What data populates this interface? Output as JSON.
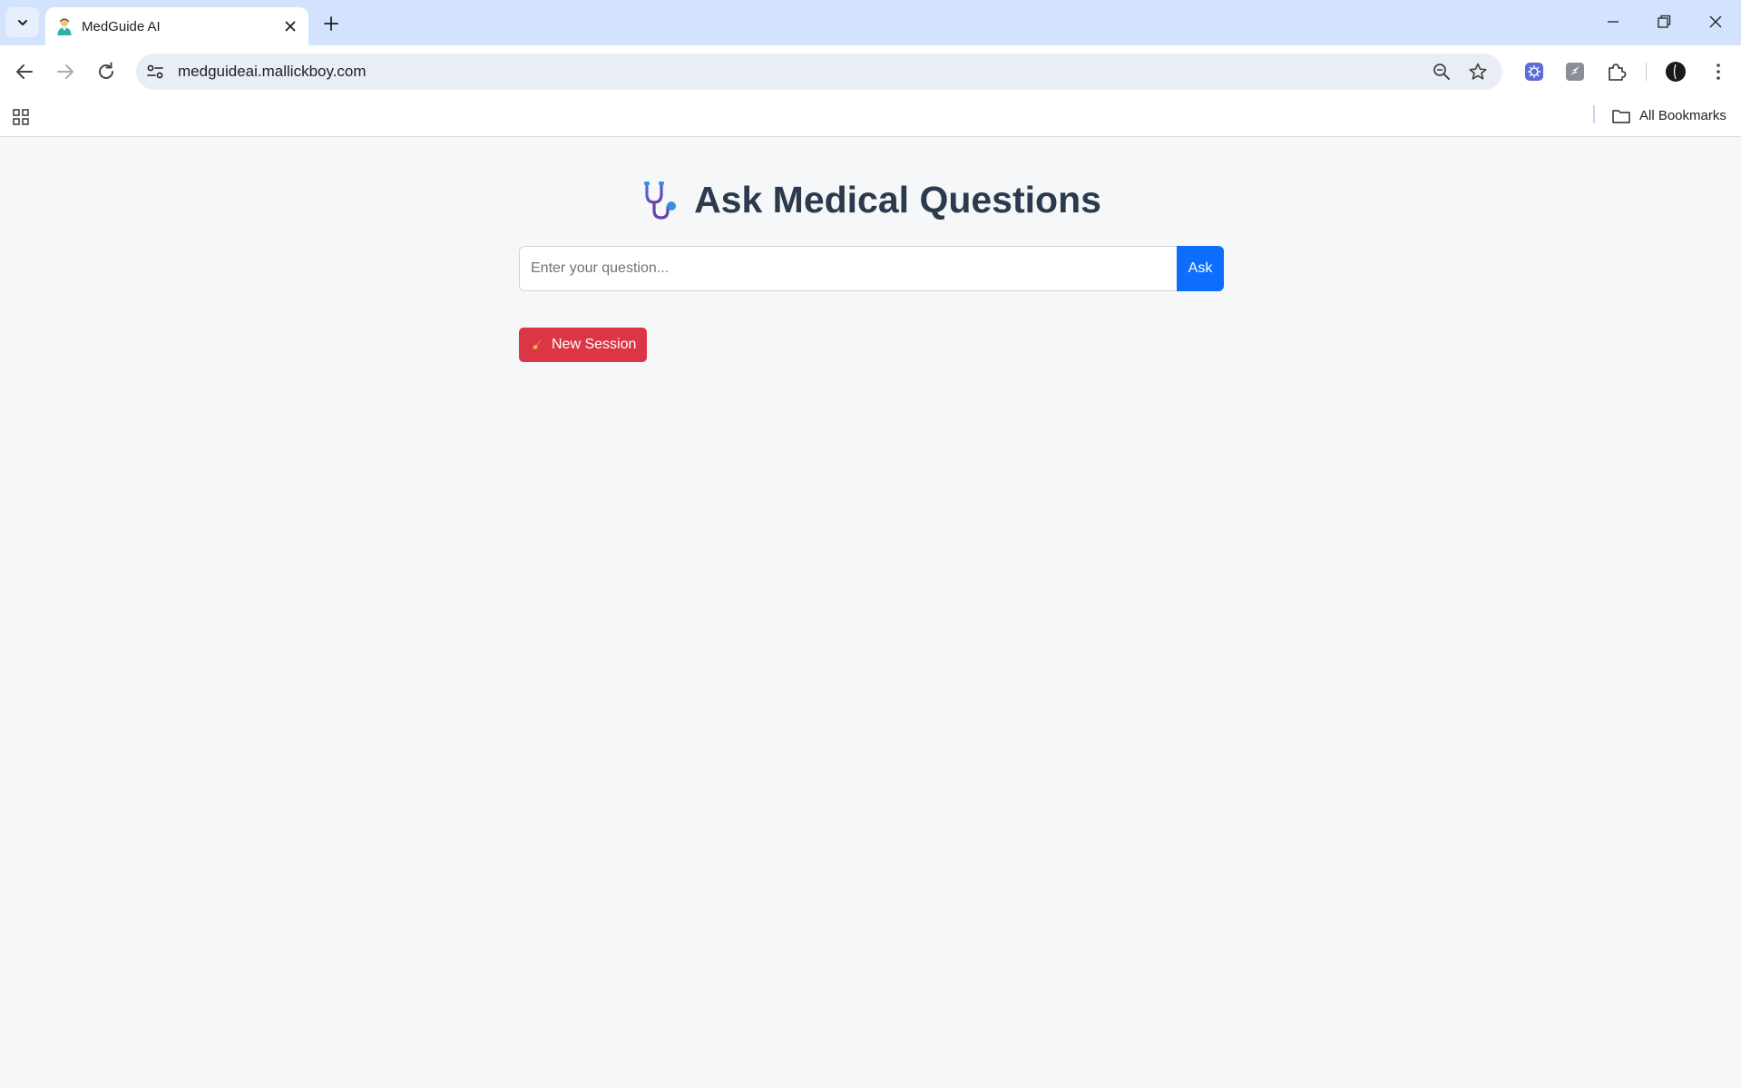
{
  "browser": {
    "tab": {
      "title": "MedGuide AI"
    },
    "address_bar": {
      "url": "medguideai.mallickboy.com"
    },
    "bookmarks": {
      "all_bookmarks_label": "All Bookmarks"
    },
    "icons": [
      "tab-search-icon",
      "favicon",
      "close-icon",
      "new-tab-icon",
      "minimize-icon",
      "restore-icon",
      "window-close-icon",
      "back-icon",
      "forward-icon",
      "reload-icon",
      "site-info-icon",
      "zoom-icon",
      "bookmark-star-icon",
      "extension-icon",
      "puzzle-icon",
      "profile-avatar",
      "more-icon",
      "apps-icon",
      "folder-icon"
    ]
  },
  "page": {
    "title": "Ask Medical Questions",
    "question_input": {
      "placeholder": "Enter your question...",
      "value": ""
    },
    "ask_button_label": "Ask",
    "new_session_label": "New Session"
  },
  "colors": {
    "primary": "#0d6efd",
    "danger": "#dc3545",
    "heading": "#2b3a4c",
    "page_background": "#f5f7f9",
    "tabstrip": "#d3e3fd"
  }
}
